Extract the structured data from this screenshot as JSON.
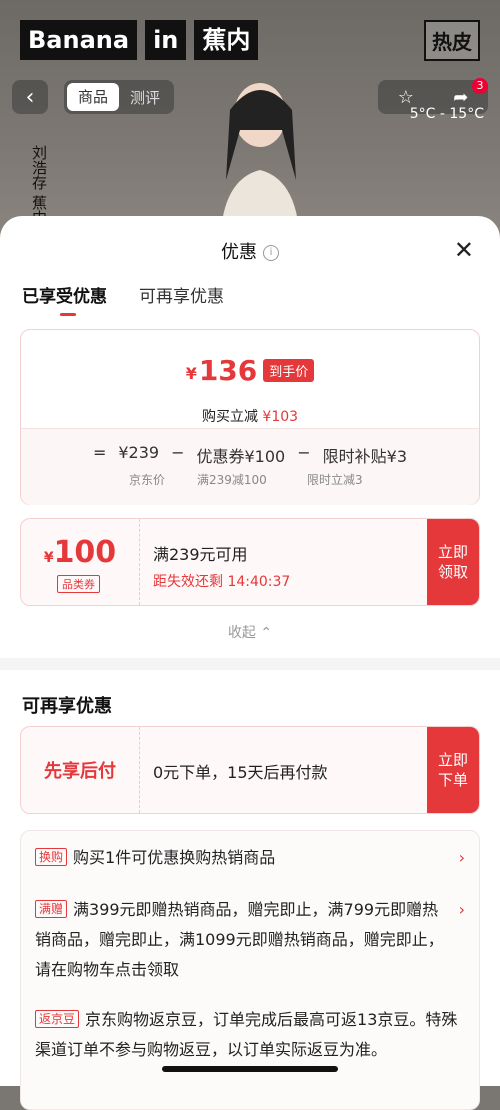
{
  "background": {
    "brand": [
      "Banana",
      "in",
      "蕉内"
    ],
    "brand_right": [
      "热皮"
    ],
    "back_icon": "chevron-left-icon",
    "segments": [
      {
        "label": "商品",
        "active": true
      },
      {
        "label": "测评",
        "active": false
      }
    ],
    "vertical_text": "刘浩存 蕉内品牌代",
    "weather": "5°C - 15°C",
    "cart_count": "3"
  },
  "sheet": {
    "title": "优惠",
    "tabs": [
      {
        "label": "已享受优惠",
        "active": true
      },
      {
        "label": "可再享优惠",
        "active": false
      }
    ],
    "summary": {
      "currency": "¥",
      "final_price": "136",
      "price_tag": "到手价",
      "save_text": "购买立减",
      "save_value": "¥103",
      "formula": [
        "=",
        "¥239",
        "−",
        "优惠券¥100",
        "−",
        "限时补贴¥3"
      ],
      "subs": [
        "京东价",
        "满239减100",
        "限时立减3"
      ]
    },
    "coupon": {
      "currency": "¥",
      "amount": "100",
      "type": "品类券",
      "condition": "满239元可用",
      "countdown": "距失效还剩 14:40:37",
      "button": "立即领取"
    },
    "collapse": "收起 ⌃",
    "more_title": "可再享优惠",
    "bnpl": {
      "label": "先享后付",
      "text": "0元下单，15天后再付款",
      "button": "立即下单"
    },
    "promos": [
      {
        "tag": "换购",
        "text": "购买1件可优惠换购热销商品"
      },
      {
        "tag": "满赠",
        "text": "满399元即赠热销商品，赠完即止，满799元即赠热销商品，赠完即止，满1099元即赠热销商品，赠完即止，请在购物车点击领取"
      },
      {
        "tag": "返京豆",
        "text": "京东购物返京豆，订单完成后最高可返13京豆。特殊渠道订单不参与购物返豆，以订单实际返豆为准。"
      }
    ]
  }
}
